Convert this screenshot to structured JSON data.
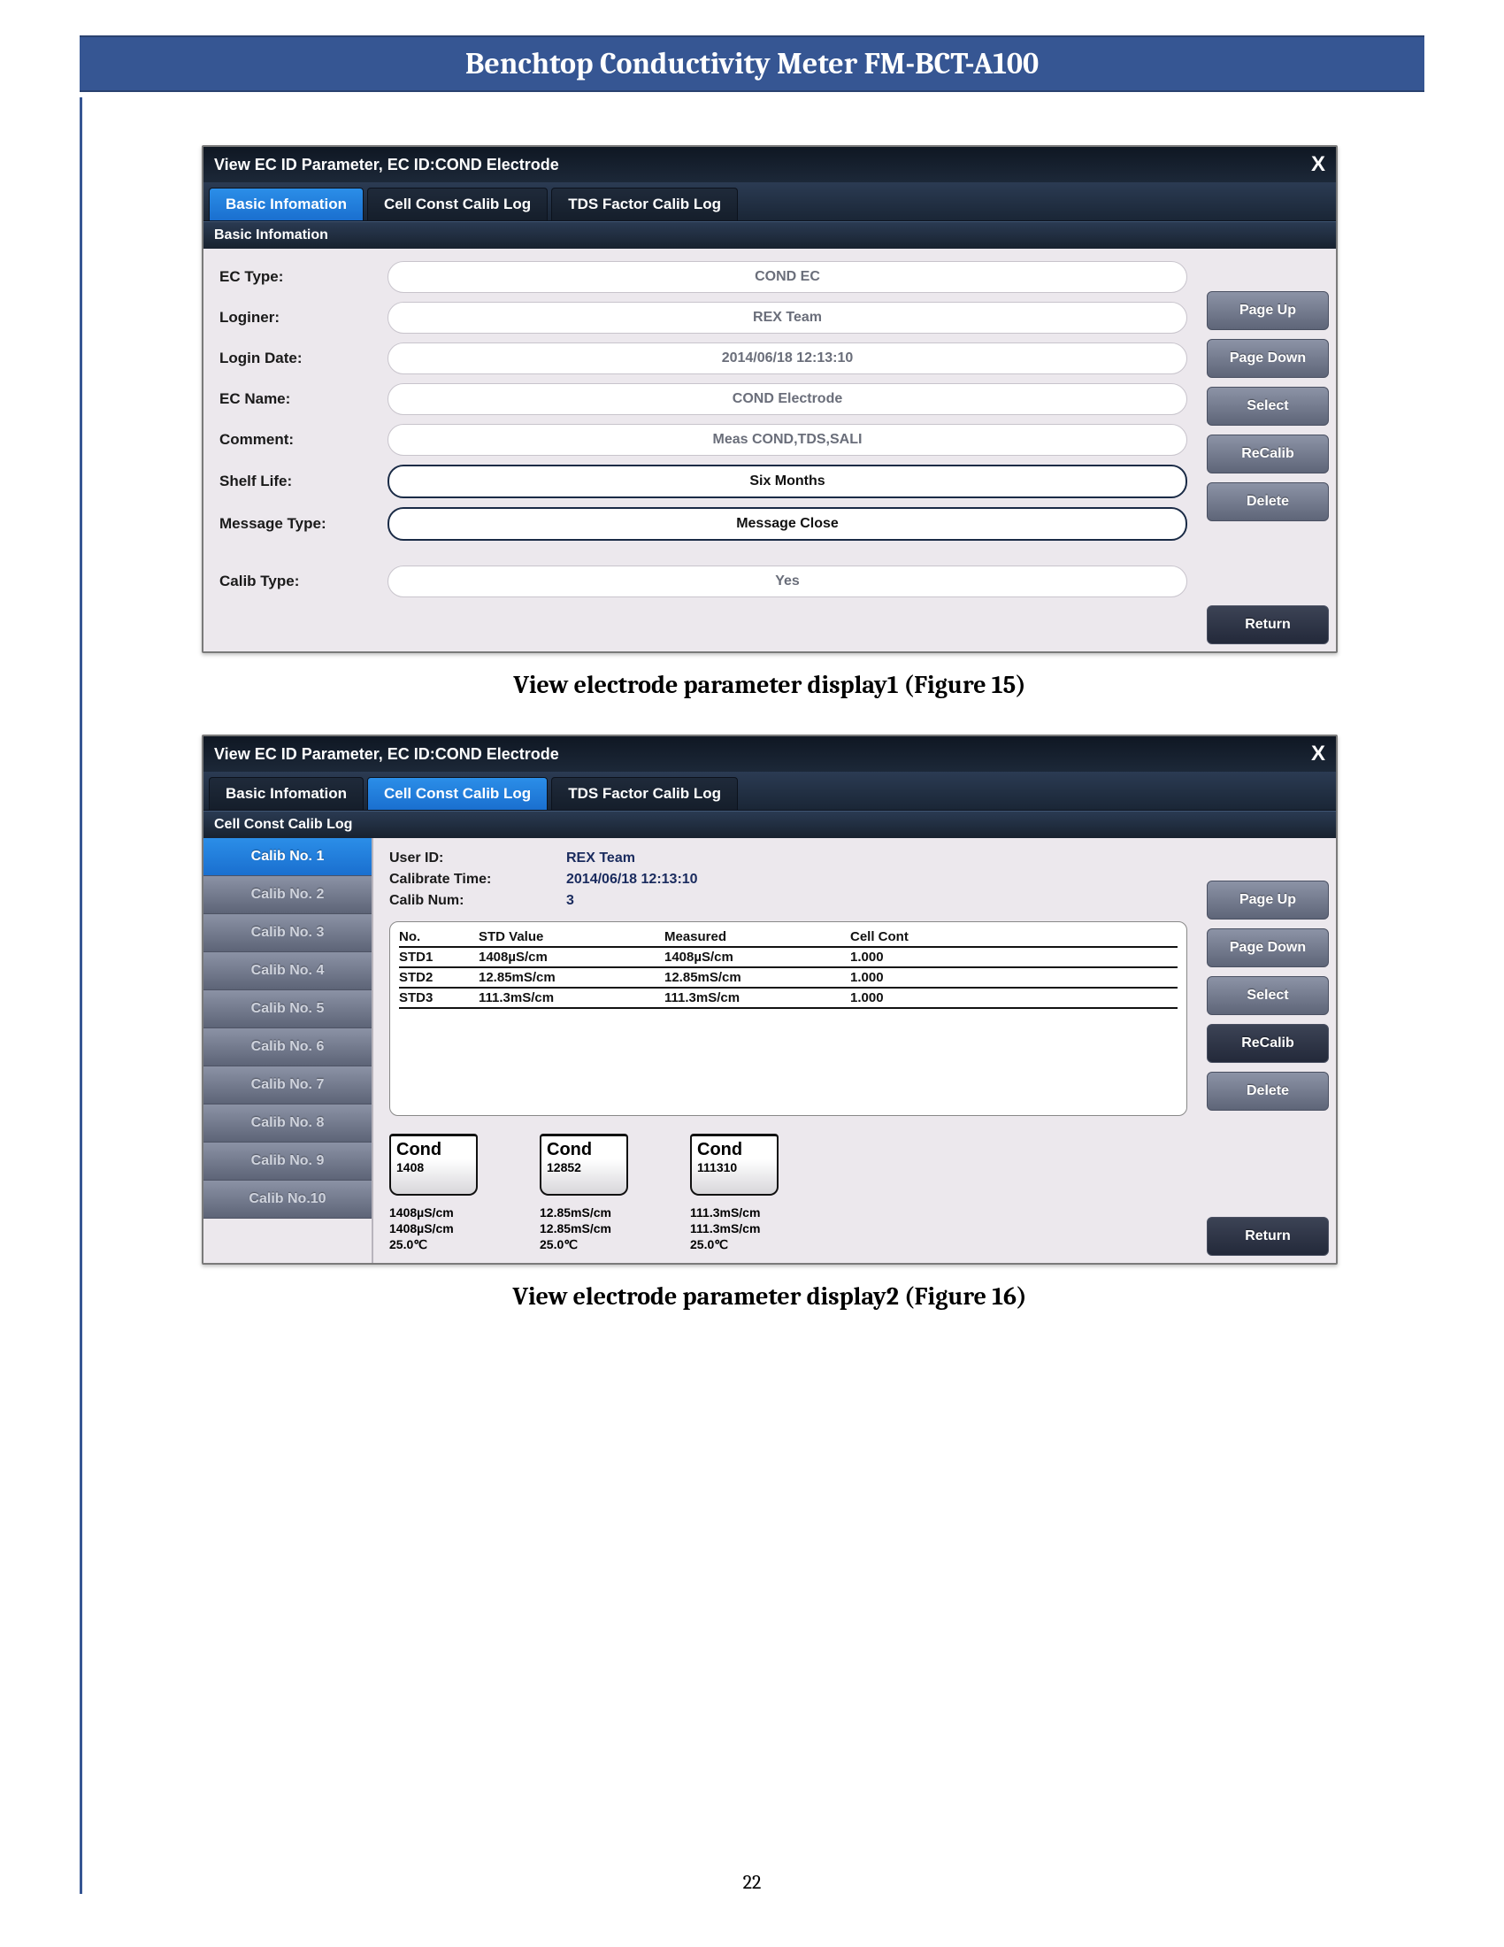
{
  "doc": {
    "title": "Benchtop Conductivity Meter FM-BCT-A100",
    "page_number": "22"
  },
  "caption1": "View electrode parameter display1 (Figure 15)",
  "caption2": "View electrode parameter display2 (Figure 16)",
  "ss1": {
    "title": "View EC ID Parameter, EC ID:COND Electrode",
    "tabs": [
      "Basic Infomation",
      "Cell Const Calib Log",
      "TDS Factor Calib Log"
    ],
    "active_tab": 0,
    "panel_subtitle": "Basic Infomation",
    "fields": {
      "ec_type": {
        "label": "EC Type:",
        "value": "COND EC"
      },
      "loginer": {
        "label": "Loginer:",
        "value": "REX Team"
      },
      "login_date": {
        "label": "Login Date:",
        "value": "2014/06/18 12:13:10"
      },
      "ec_name": {
        "label": "EC Name:",
        "value": "COND Electrode"
      },
      "comment": {
        "label": "Comment:",
        "value": "Meas COND,TDS,SALI"
      },
      "shelf_life": {
        "label": "Shelf Life:",
        "value": "Six Months"
      },
      "msg_type": {
        "label": "Message Type:",
        "value": "Message Close"
      },
      "calib_type": {
        "label": "Calib Type:",
        "value": "Yes"
      }
    },
    "side": [
      "Page Up",
      "Page Down",
      "Select",
      "ReCalib",
      "Delete",
      "Return"
    ]
  },
  "ss2": {
    "title": "View EC ID Parameter, EC ID:COND Electrode",
    "tabs": [
      "Basic Infomation",
      "Cell Const Calib Log",
      "TDS Factor Calib Log"
    ],
    "active_tab": 1,
    "panel_subtitle": "Cell Const Calib Log",
    "calib_items": [
      "Calib No. 1",
      "Calib No. 2",
      "Calib No. 3",
      "Calib No. 4",
      "Calib No. 5",
      "Calib No. 6",
      "Calib No. 7",
      "Calib No. 8",
      "Calib No. 9",
      "Calib No.10"
    ],
    "active_calib": 0,
    "info": {
      "user_id": {
        "label": "User ID:",
        "value": "REX Team"
      },
      "calib_time": {
        "label": "Calibrate Time:",
        "value": "2014/06/18 12:13:10"
      },
      "calib_num": {
        "label": "Calib Num:",
        "value": "3"
      }
    },
    "table": {
      "headers": [
        "No.",
        "STD Value",
        "Measured",
        "Cell Cont"
      ],
      "rows": [
        [
          "STD1",
          "1408µS/cm",
          "1408µS/cm",
          "1.000"
        ],
        [
          "STD2",
          "12.85mS/cm",
          "12.85mS/cm",
          "1.000"
        ],
        [
          "STD3",
          "111.3mS/cm",
          "111.3mS/cm",
          "1.000"
        ]
      ]
    },
    "beakers": [
      {
        "title": "Cond",
        "num": "1408",
        "l1": "1408µS/cm",
        "l2": "1408µS/cm",
        "l3": "25.0℃"
      },
      {
        "title": "Cond",
        "num": "12852",
        "l1": "12.85mS/cm",
        "l2": "12.85mS/cm",
        "l3": "25.0℃"
      },
      {
        "title": "Cond",
        "num": "111310",
        "l1": "111.3mS/cm",
        "l2": "111.3mS/cm",
        "l3": "25.0℃"
      }
    ],
    "side": [
      "Page Up",
      "Page Down",
      "Select",
      "ReCalib",
      "Delete",
      "Return"
    ]
  }
}
